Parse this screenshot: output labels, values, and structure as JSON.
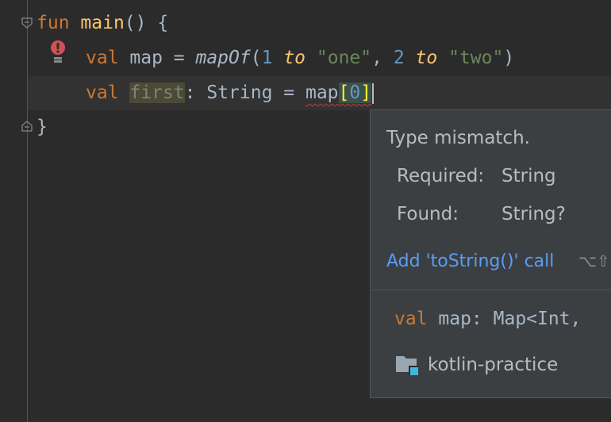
{
  "editor": {
    "line1": {
      "kw": "fun",
      "name": "main",
      "rest": "() {"
    },
    "line2": {
      "kw": "val",
      "name": " map = ",
      "call": "mapOf",
      "open": "(",
      "n1": "1",
      "to1": "to",
      "s1": "\"one\"",
      "comma": ", ",
      "n2": "2",
      "to2": "to",
      "s2": "\"two\"",
      "close": ")"
    },
    "line3": {
      "kw": "val",
      "var": "first",
      "type_part": ": String = ",
      "map": "map",
      "lb": "[",
      "index": "0",
      "rb": "]"
    },
    "line4": {
      "brace": "}"
    }
  },
  "gutter": {
    "error_icon": "error-icon",
    "fold_icon": "fold-icon"
  },
  "popup": {
    "title": "Type mismatch.",
    "required_label": "Required:",
    "required_value": "String",
    "found_label": "Found:",
    "found_value": "String?",
    "action": "Add 'toString()' call",
    "shortcut": "⌥⇧",
    "declaration": {
      "kw": "val",
      "text": " map: Map<Int,"
    },
    "module_icon": "module-folder-icon",
    "module": "kotlin-practice"
  },
  "colors": {
    "background": "#2b2b2b",
    "keyword": "#cc7832",
    "function": "#ffc66d",
    "number": "#6897bb",
    "string": "#6a8759",
    "link": "#589df6",
    "error": "#bc3f3c"
  }
}
